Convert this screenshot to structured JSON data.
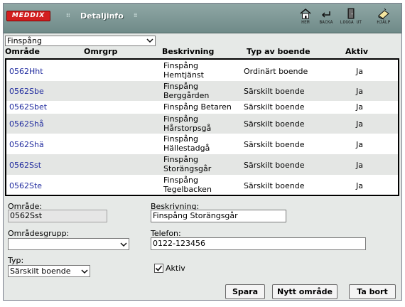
{
  "header": {
    "logo": "MEDDIX",
    "title": "Detaljinfo",
    "nav": [
      {
        "label": "HEM",
        "icon": "home-icon"
      },
      {
        "label": "BACKA",
        "icon": "back-arrow-icon"
      },
      {
        "label": "LOGGA UT",
        "icon": "logout-door-icon"
      },
      {
        "label": "HJÄLP",
        "icon": "help-book-icon"
      }
    ]
  },
  "filter": {
    "value": "Finspång"
  },
  "columns": {
    "omrade": "Område",
    "omrgrp": "Omrgrp",
    "beskrivning": "Beskrivning",
    "typ": "Typ av boende",
    "aktiv": "Aktiv"
  },
  "rows": [
    {
      "code": "0562Hht",
      "desc1": "Finspång",
      "desc2": "Hemtjänst",
      "typ": "Ordinärt boende",
      "aktiv": "Ja"
    },
    {
      "code": "0562Sbe",
      "desc1": "Finspång",
      "desc2": "Berggården",
      "typ": "Särskilt boende",
      "aktiv": "Ja"
    },
    {
      "code": "0562Sbet",
      "desc1": "Finspång Betaren",
      "desc2": "",
      "typ": "Särskilt boende",
      "aktiv": "Ja"
    },
    {
      "code": "0562Shå",
      "desc1": "Finspång",
      "desc2": "Hårstorpsgå",
      "typ": "Särskilt boende",
      "aktiv": "Ja"
    },
    {
      "code": "0562Shä",
      "desc1": "Finspång",
      "desc2": "Hällestadgå",
      "typ": "Särskilt boende",
      "aktiv": "Ja"
    },
    {
      "code": "0562Sst",
      "desc1": "Finspång",
      "desc2": "Storängsgår",
      "typ": "Särskilt boende",
      "aktiv": "Ja"
    },
    {
      "code": "0562Ste",
      "desc1": "Finspång",
      "desc2": "Tegelbacken",
      "typ": "Särskilt boende",
      "aktiv": "Ja"
    }
  ],
  "form": {
    "omrade_label": "Område:",
    "omrade_value": "0562Sst",
    "beskrivning_label": "Beskrivning:",
    "beskrivning_value": "Finspång Storängsgår",
    "omradesgrupp_label": "Områdesgrupp:",
    "omradesgrupp_value": "",
    "telefon_label": "Telefon:",
    "telefon_value": "0122-123456",
    "typ_label": "Typ:",
    "typ_value": "Särskilt boende",
    "aktiv_label": "Aktiv",
    "aktiv_checked": true
  },
  "buttons": {
    "spara": "Spara",
    "nytt": "Nytt område",
    "tabort": "Ta bort"
  },
  "colors": {
    "header": "#7f9896",
    "link": "#1f2a9e",
    "alt_row": "#e4e6e4",
    "logo": "#d21f1f"
  }
}
